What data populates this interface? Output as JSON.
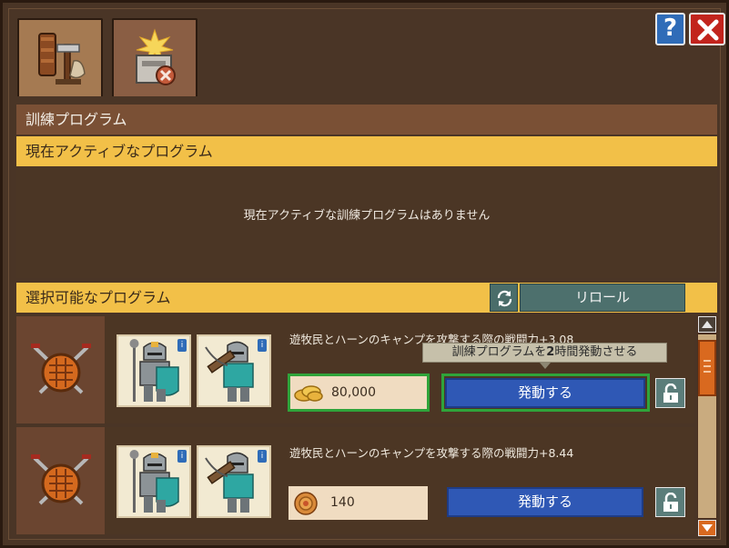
{
  "window": {
    "tabs": [
      {
        "name": "training-tab",
        "icon": "signpost-icon",
        "active": true
      },
      {
        "name": "ritual-tab",
        "icon": "stone-altar-icon",
        "active": false
      }
    ],
    "help_label": "?",
    "close_icon": "close-icon"
  },
  "section_title": "訓練プログラム",
  "active_programs": {
    "header": "現在アクティブなプログラム",
    "empty_message": "現在アクティブな訓練プログラムはありません"
  },
  "available_programs": {
    "header": "選択可能なプログラム",
    "reroll_icon": "refresh-icon",
    "reroll_label": "リロール",
    "items": [
      {
        "emblem": "crossed-swords-shield-icon",
        "units": [
          "mace-knight-icon",
          "crossbow-knight-icon"
        ],
        "description": "遊牧民とハーンのキャンプを攻撃する際の戦闘力+3.08",
        "cost_icon": "gold-coins-icon",
        "cost": "80,000",
        "activate_label": "発動する",
        "lock_icon": "padlock-icon",
        "highlighted": true
      },
      {
        "emblem": "crossed-swords-shield-icon",
        "units": [
          "mace-knight-icon",
          "crossbow-knight-icon"
        ],
        "description": "遊牧民とハーンのキャンプを攻撃する際の戦闘力+8.44",
        "cost_icon": "ruby-medallion-icon",
        "cost": "140",
        "activate_label": "発動する",
        "lock_icon": "padlock-icon",
        "highlighted": false
      }
    ]
  },
  "tooltip": {
    "prefix": "訓練プログラムを",
    "hours": "2",
    "suffix": "時間発動させる"
  },
  "colors": {
    "accent_yellow": "#f2c048",
    "activate_blue": "#2f58b5",
    "highlight_green": "#2fa43a",
    "close_red": "#c2241d"
  }
}
